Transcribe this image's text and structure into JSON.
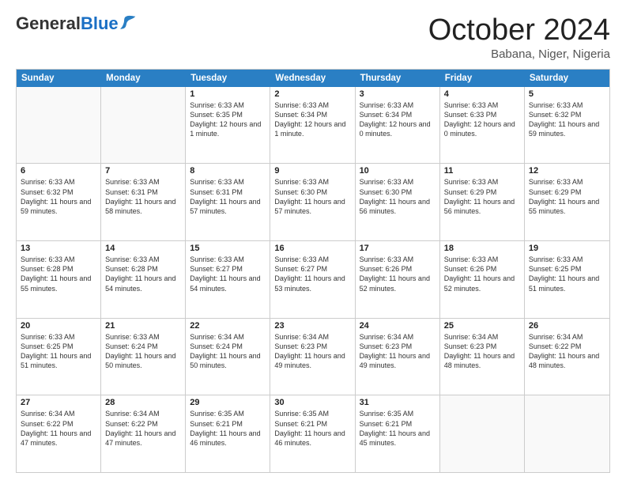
{
  "header": {
    "logo_general": "General",
    "logo_blue": "Blue",
    "month_title": "October 2024",
    "location": "Babana, Niger, Nigeria"
  },
  "days_of_week": [
    "Sunday",
    "Monday",
    "Tuesday",
    "Wednesday",
    "Thursday",
    "Friday",
    "Saturday"
  ],
  "weeks": [
    [
      {
        "day": "",
        "sunrise": "",
        "sunset": "",
        "daylight": "",
        "empty": true
      },
      {
        "day": "",
        "sunrise": "",
        "sunset": "",
        "daylight": "",
        "empty": true
      },
      {
        "day": "1",
        "sunrise": "Sunrise: 6:33 AM",
        "sunset": "Sunset: 6:35 PM",
        "daylight": "Daylight: 12 hours and 1 minute.",
        "empty": false
      },
      {
        "day": "2",
        "sunrise": "Sunrise: 6:33 AM",
        "sunset": "Sunset: 6:34 PM",
        "daylight": "Daylight: 12 hours and 1 minute.",
        "empty": false
      },
      {
        "day": "3",
        "sunrise": "Sunrise: 6:33 AM",
        "sunset": "Sunset: 6:34 PM",
        "daylight": "Daylight: 12 hours and 0 minutes.",
        "empty": false
      },
      {
        "day": "4",
        "sunrise": "Sunrise: 6:33 AM",
        "sunset": "Sunset: 6:33 PM",
        "daylight": "Daylight: 12 hours and 0 minutes.",
        "empty": false
      },
      {
        "day": "5",
        "sunrise": "Sunrise: 6:33 AM",
        "sunset": "Sunset: 6:32 PM",
        "daylight": "Daylight: 11 hours and 59 minutes.",
        "empty": false
      }
    ],
    [
      {
        "day": "6",
        "sunrise": "Sunrise: 6:33 AM",
        "sunset": "Sunset: 6:32 PM",
        "daylight": "Daylight: 11 hours and 59 minutes.",
        "empty": false
      },
      {
        "day": "7",
        "sunrise": "Sunrise: 6:33 AM",
        "sunset": "Sunset: 6:31 PM",
        "daylight": "Daylight: 11 hours and 58 minutes.",
        "empty": false
      },
      {
        "day": "8",
        "sunrise": "Sunrise: 6:33 AM",
        "sunset": "Sunset: 6:31 PM",
        "daylight": "Daylight: 11 hours and 57 minutes.",
        "empty": false
      },
      {
        "day": "9",
        "sunrise": "Sunrise: 6:33 AM",
        "sunset": "Sunset: 6:30 PM",
        "daylight": "Daylight: 11 hours and 57 minutes.",
        "empty": false
      },
      {
        "day": "10",
        "sunrise": "Sunrise: 6:33 AM",
        "sunset": "Sunset: 6:30 PM",
        "daylight": "Daylight: 11 hours and 56 minutes.",
        "empty": false
      },
      {
        "day": "11",
        "sunrise": "Sunrise: 6:33 AM",
        "sunset": "Sunset: 6:29 PM",
        "daylight": "Daylight: 11 hours and 56 minutes.",
        "empty": false
      },
      {
        "day": "12",
        "sunrise": "Sunrise: 6:33 AM",
        "sunset": "Sunset: 6:29 PM",
        "daylight": "Daylight: 11 hours and 55 minutes.",
        "empty": false
      }
    ],
    [
      {
        "day": "13",
        "sunrise": "Sunrise: 6:33 AM",
        "sunset": "Sunset: 6:28 PM",
        "daylight": "Daylight: 11 hours and 55 minutes.",
        "empty": false
      },
      {
        "day": "14",
        "sunrise": "Sunrise: 6:33 AM",
        "sunset": "Sunset: 6:28 PM",
        "daylight": "Daylight: 11 hours and 54 minutes.",
        "empty": false
      },
      {
        "day": "15",
        "sunrise": "Sunrise: 6:33 AM",
        "sunset": "Sunset: 6:27 PM",
        "daylight": "Daylight: 11 hours and 54 minutes.",
        "empty": false
      },
      {
        "day": "16",
        "sunrise": "Sunrise: 6:33 AM",
        "sunset": "Sunset: 6:27 PM",
        "daylight": "Daylight: 11 hours and 53 minutes.",
        "empty": false
      },
      {
        "day": "17",
        "sunrise": "Sunrise: 6:33 AM",
        "sunset": "Sunset: 6:26 PM",
        "daylight": "Daylight: 11 hours and 52 minutes.",
        "empty": false
      },
      {
        "day": "18",
        "sunrise": "Sunrise: 6:33 AM",
        "sunset": "Sunset: 6:26 PM",
        "daylight": "Daylight: 11 hours and 52 minutes.",
        "empty": false
      },
      {
        "day": "19",
        "sunrise": "Sunrise: 6:33 AM",
        "sunset": "Sunset: 6:25 PM",
        "daylight": "Daylight: 11 hours and 51 minutes.",
        "empty": false
      }
    ],
    [
      {
        "day": "20",
        "sunrise": "Sunrise: 6:33 AM",
        "sunset": "Sunset: 6:25 PM",
        "daylight": "Daylight: 11 hours and 51 minutes.",
        "empty": false
      },
      {
        "day": "21",
        "sunrise": "Sunrise: 6:33 AM",
        "sunset": "Sunset: 6:24 PM",
        "daylight": "Daylight: 11 hours and 50 minutes.",
        "empty": false
      },
      {
        "day": "22",
        "sunrise": "Sunrise: 6:34 AM",
        "sunset": "Sunset: 6:24 PM",
        "daylight": "Daylight: 11 hours and 50 minutes.",
        "empty": false
      },
      {
        "day": "23",
        "sunrise": "Sunrise: 6:34 AM",
        "sunset": "Sunset: 6:23 PM",
        "daylight": "Daylight: 11 hours and 49 minutes.",
        "empty": false
      },
      {
        "day": "24",
        "sunrise": "Sunrise: 6:34 AM",
        "sunset": "Sunset: 6:23 PM",
        "daylight": "Daylight: 11 hours and 49 minutes.",
        "empty": false
      },
      {
        "day": "25",
        "sunrise": "Sunrise: 6:34 AM",
        "sunset": "Sunset: 6:23 PM",
        "daylight": "Daylight: 11 hours and 48 minutes.",
        "empty": false
      },
      {
        "day": "26",
        "sunrise": "Sunrise: 6:34 AM",
        "sunset": "Sunset: 6:22 PM",
        "daylight": "Daylight: 11 hours and 48 minutes.",
        "empty": false
      }
    ],
    [
      {
        "day": "27",
        "sunrise": "Sunrise: 6:34 AM",
        "sunset": "Sunset: 6:22 PM",
        "daylight": "Daylight: 11 hours and 47 minutes.",
        "empty": false
      },
      {
        "day": "28",
        "sunrise": "Sunrise: 6:34 AM",
        "sunset": "Sunset: 6:22 PM",
        "daylight": "Daylight: 11 hours and 47 minutes.",
        "empty": false
      },
      {
        "day": "29",
        "sunrise": "Sunrise: 6:35 AM",
        "sunset": "Sunset: 6:21 PM",
        "daylight": "Daylight: 11 hours and 46 minutes.",
        "empty": false
      },
      {
        "day": "30",
        "sunrise": "Sunrise: 6:35 AM",
        "sunset": "Sunset: 6:21 PM",
        "daylight": "Daylight: 11 hours and 46 minutes.",
        "empty": false
      },
      {
        "day": "31",
        "sunrise": "Sunrise: 6:35 AM",
        "sunset": "Sunset: 6:21 PM",
        "daylight": "Daylight: 11 hours and 45 minutes.",
        "empty": false
      },
      {
        "day": "",
        "sunrise": "",
        "sunset": "",
        "daylight": "",
        "empty": true
      },
      {
        "day": "",
        "sunrise": "",
        "sunset": "",
        "daylight": "",
        "empty": true
      }
    ]
  ]
}
